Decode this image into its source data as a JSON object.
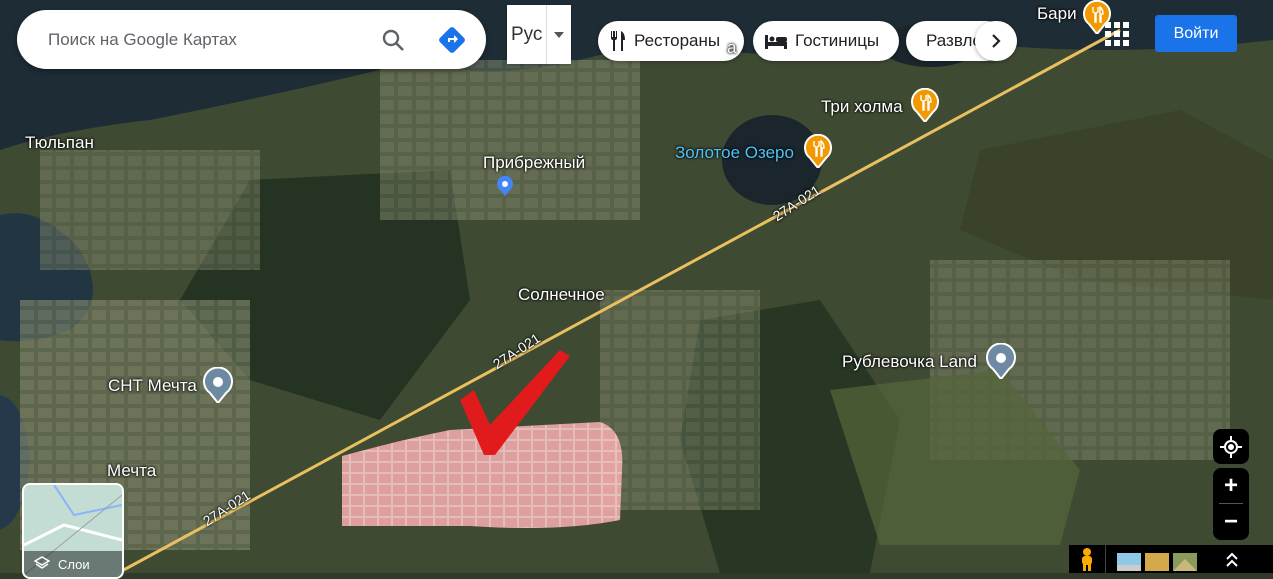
{
  "search": {
    "placeholder": "Поиск на Google Картах"
  },
  "language": {
    "current": "Рус"
  },
  "chips": [
    {
      "label": "Рестораны",
      "icon": "fork-knife-icon"
    },
    {
      "label": "Гостиницы",
      "icon": "bed-icon"
    },
    {
      "label": "Развлечения",
      "icon": "camera-icon"
    }
  ],
  "header": {
    "signin_label": "Войти"
  },
  "places": {
    "bari": "Бари",
    "tri_holma": "Три холма",
    "zolotoe_ozero": "Золотое Озеро",
    "tyulpan": "Тюльпан",
    "pribrezhny": "Прибрежный",
    "solnechnoe": "Солнечное",
    "rublevochka": "Рублевочка Land",
    "snt_mechta": "СНТ Мечта",
    "mechta": "Мечта",
    "partial_top": "а"
  },
  "roads": {
    "r1": "27А-021",
    "r2": "27А-021",
    "r3": "27А-021"
  },
  "layers": {
    "label": "Слои"
  },
  "colors": {
    "accent": "#1a73e8",
    "restaurant_pin": "#f29900",
    "checkmark": "#e11b1b",
    "plot": "#f4b6b6"
  }
}
